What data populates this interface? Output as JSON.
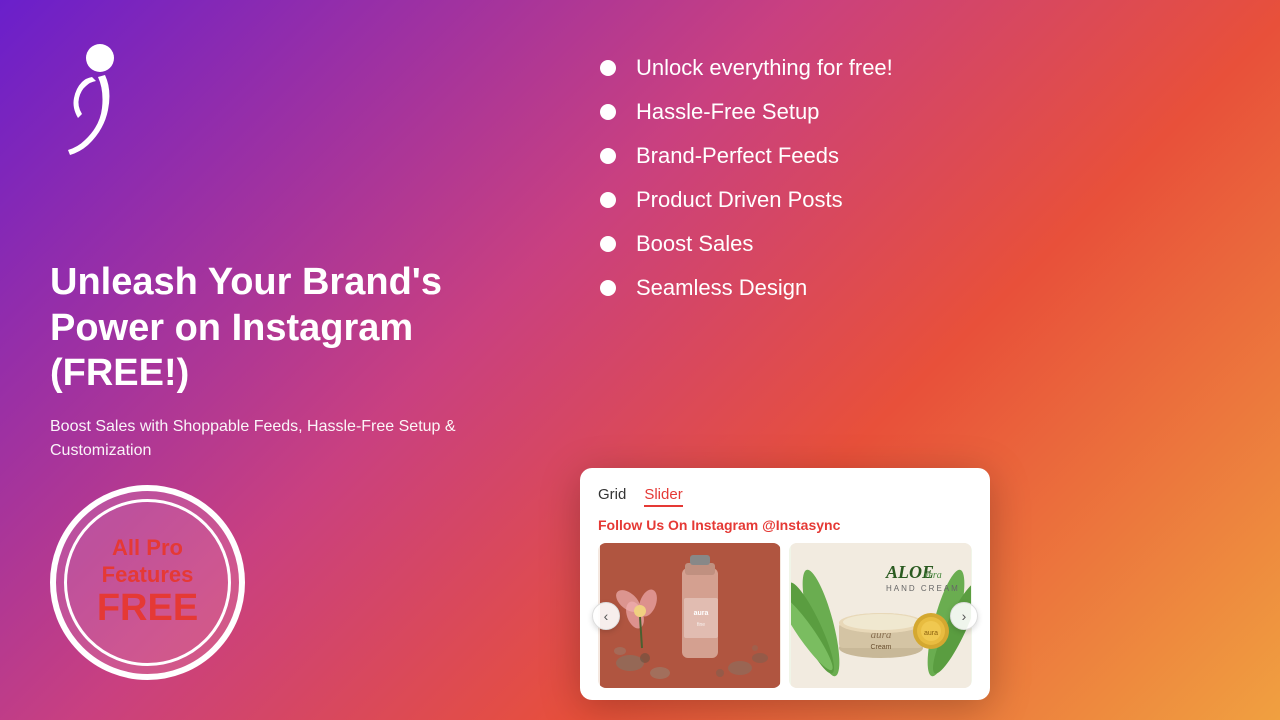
{
  "background": {
    "gradient_start": "#6a1fcb",
    "gradient_end": "#f0a040"
  },
  "logo": {
    "alt": "Instasync logo"
  },
  "headline": {
    "line1": "Unleash Your Brand's",
    "line2": "Power on Instagram (FREE!)"
  },
  "subtitle": "Boost Sales with Shoppable Feeds, Hassle-Free Setup & Customization",
  "badge": {
    "line1": "All Pro",
    "line2": "Features",
    "free": "FREE"
  },
  "features": [
    "Unlock everything for free!",
    "Hassle-Free Setup",
    "Brand-Perfect Feeds",
    "Product Driven Posts",
    "Boost Sales",
    "Seamless Design"
  ],
  "widget": {
    "tabs": [
      {
        "label": "Grid",
        "active": false
      },
      {
        "label": "Slider",
        "active": true
      }
    ],
    "follow_text": "Follow Us On Instagram",
    "handle": "@Instasync",
    "prev_icon": "‹",
    "next_icon": "›",
    "images": [
      {
        "alt": "Perfume product on terracotta background"
      },
      {
        "alt": "Aloe vera hand cream product"
      }
    ]
  }
}
